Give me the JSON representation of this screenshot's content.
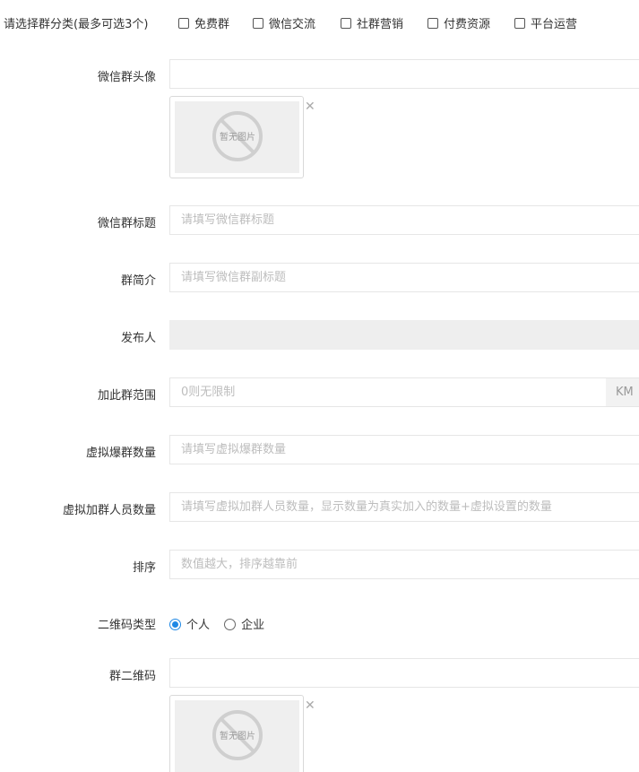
{
  "category": {
    "label": "请选择群分类(最多可选3个)",
    "options": [
      {
        "label": "免费群",
        "checked": false
      },
      {
        "label": "微信交流",
        "checked": false
      },
      {
        "label": "社群营销",
        "checked": false
      },
      {
        "label": "付费资源",
        "checked": false
      },
      {
        "label": "平台运营",
        "checked": false
      }
    ]
  },
  "avatar": {
    "label": "微信群头像",
    "value": "",
    "placeholder_text": "暂无图片",
    "remove_icon": "close-icon"
  },
  "title": {
    "label": "微信群标题",
    "placeholder": "请填写微信群标题"
  },
  "intro": {
    "label": "群简介",
    "placeholder": "请填写微信群副标题"
  },
  "publisher": {
    "label": "发布人",
    "value": ""
  },
  "range": {
    "label": "加此群范围",
    "placeholder": "0则无限制",
    "suffix": "KM"
  },
  "virtual_groups": {
    "label": "虚拟爆群数量",
    "placeholder": "请填写虚拟爆群数量"
  },
  "virtual_members": {
    "label": "虚拟加群人员数量",
    "placeholder": "请填写虚拟加群人员数量，显示数量为真实加入的数量+虚拟设置的数量"
  },
  "sort": {
    "label": "排序",
    "placeholder": "数值越大，排序越靠前"
  },
  "qr_type": {
    "label": "二维码类型",
    "options": [
      {
        "label": "个人",
        "selected": true
      },
      {
        "label": "企业",
        "selected": false
      }
    ]
  },
  "qr_code": {
    "label": "群二维码",
    "value": "",
    "placeholder_text": "暂无图片",
    "remove_icon": "close-icon"
  },
  "colors": {
    "accent": "#1e88e5",
    "border": "#e6e6e6",
    "placeholder": "#bdbdbd",
    "disabled_bg": "#eeeeee"
  }
}
